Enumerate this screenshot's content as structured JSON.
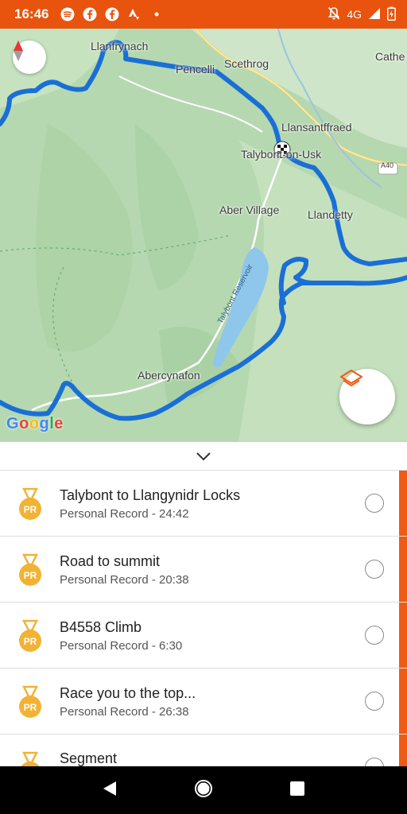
{
  "status_bar": {
    "time": "16:46",
    "left_icons": [
      "spotify-icon",
      "facebook-icon",
      "facebook-icon",
      "strava-icon",
      "dot-icon"
    ],
    "network": "4G",
    "right_icons": [
      "mute-icon",
      "signal-icon",
      "battery-icon"
    ],
    "background": "#e8530e"
  },
  "map": {
    "labels": {
      "llanfrynach": "Llanfrynach",
      "pencelli": "Pencelli",
      "scethrog": "Scethrog",
      "cathe": "Cathe",
      "llansantffraed": "Llansantffraed",
      "talybont": "Talybont-on-Usk",
      "aber_village": "Aber Village",
      "llandetty": "Llandetty",
      "aber_cynafon": "Abercynafon",
      "reservoir": "Talybont Reservoir",
      "road_a40": "A40"
    },
    "google_logo": "Google",
    "route_color": "#1a73e8",
    "compass_icon": "compass-icon",
    "layers_icon": "layers-icon"
  },
  "collapse": {
    "icon": "chevron-down-icon"
  },
  "segments": [
    {
      "title": "Talybont to Llangynidr Locks",
      "subtitle": "Personal Record - 24:42",
      "badge": "PR"
    },
    {
      "title": "Road to summit",
      "subtitle": "Personal Record - 20:38",
      "badge": "PR"
    },
    {
      "title": "B4558 Climb",
      "subtitle": "Personal Record - 6:30",
      "badge": "PR"
    },
    {
      "title": "Race you to the top...",
      "subtitle": "Personal Record - 26:38",
      "badge": "PR"
    },
    {
      "title": "Segment",
      "subtitle": "",
      "badge": ""
    }
  ],
  "accent_color": "#f05a12",
  "nav": {
    "icons": [
      "back-icon",
      "home-icon",
      "recents-icon"
    ]
  }
}
